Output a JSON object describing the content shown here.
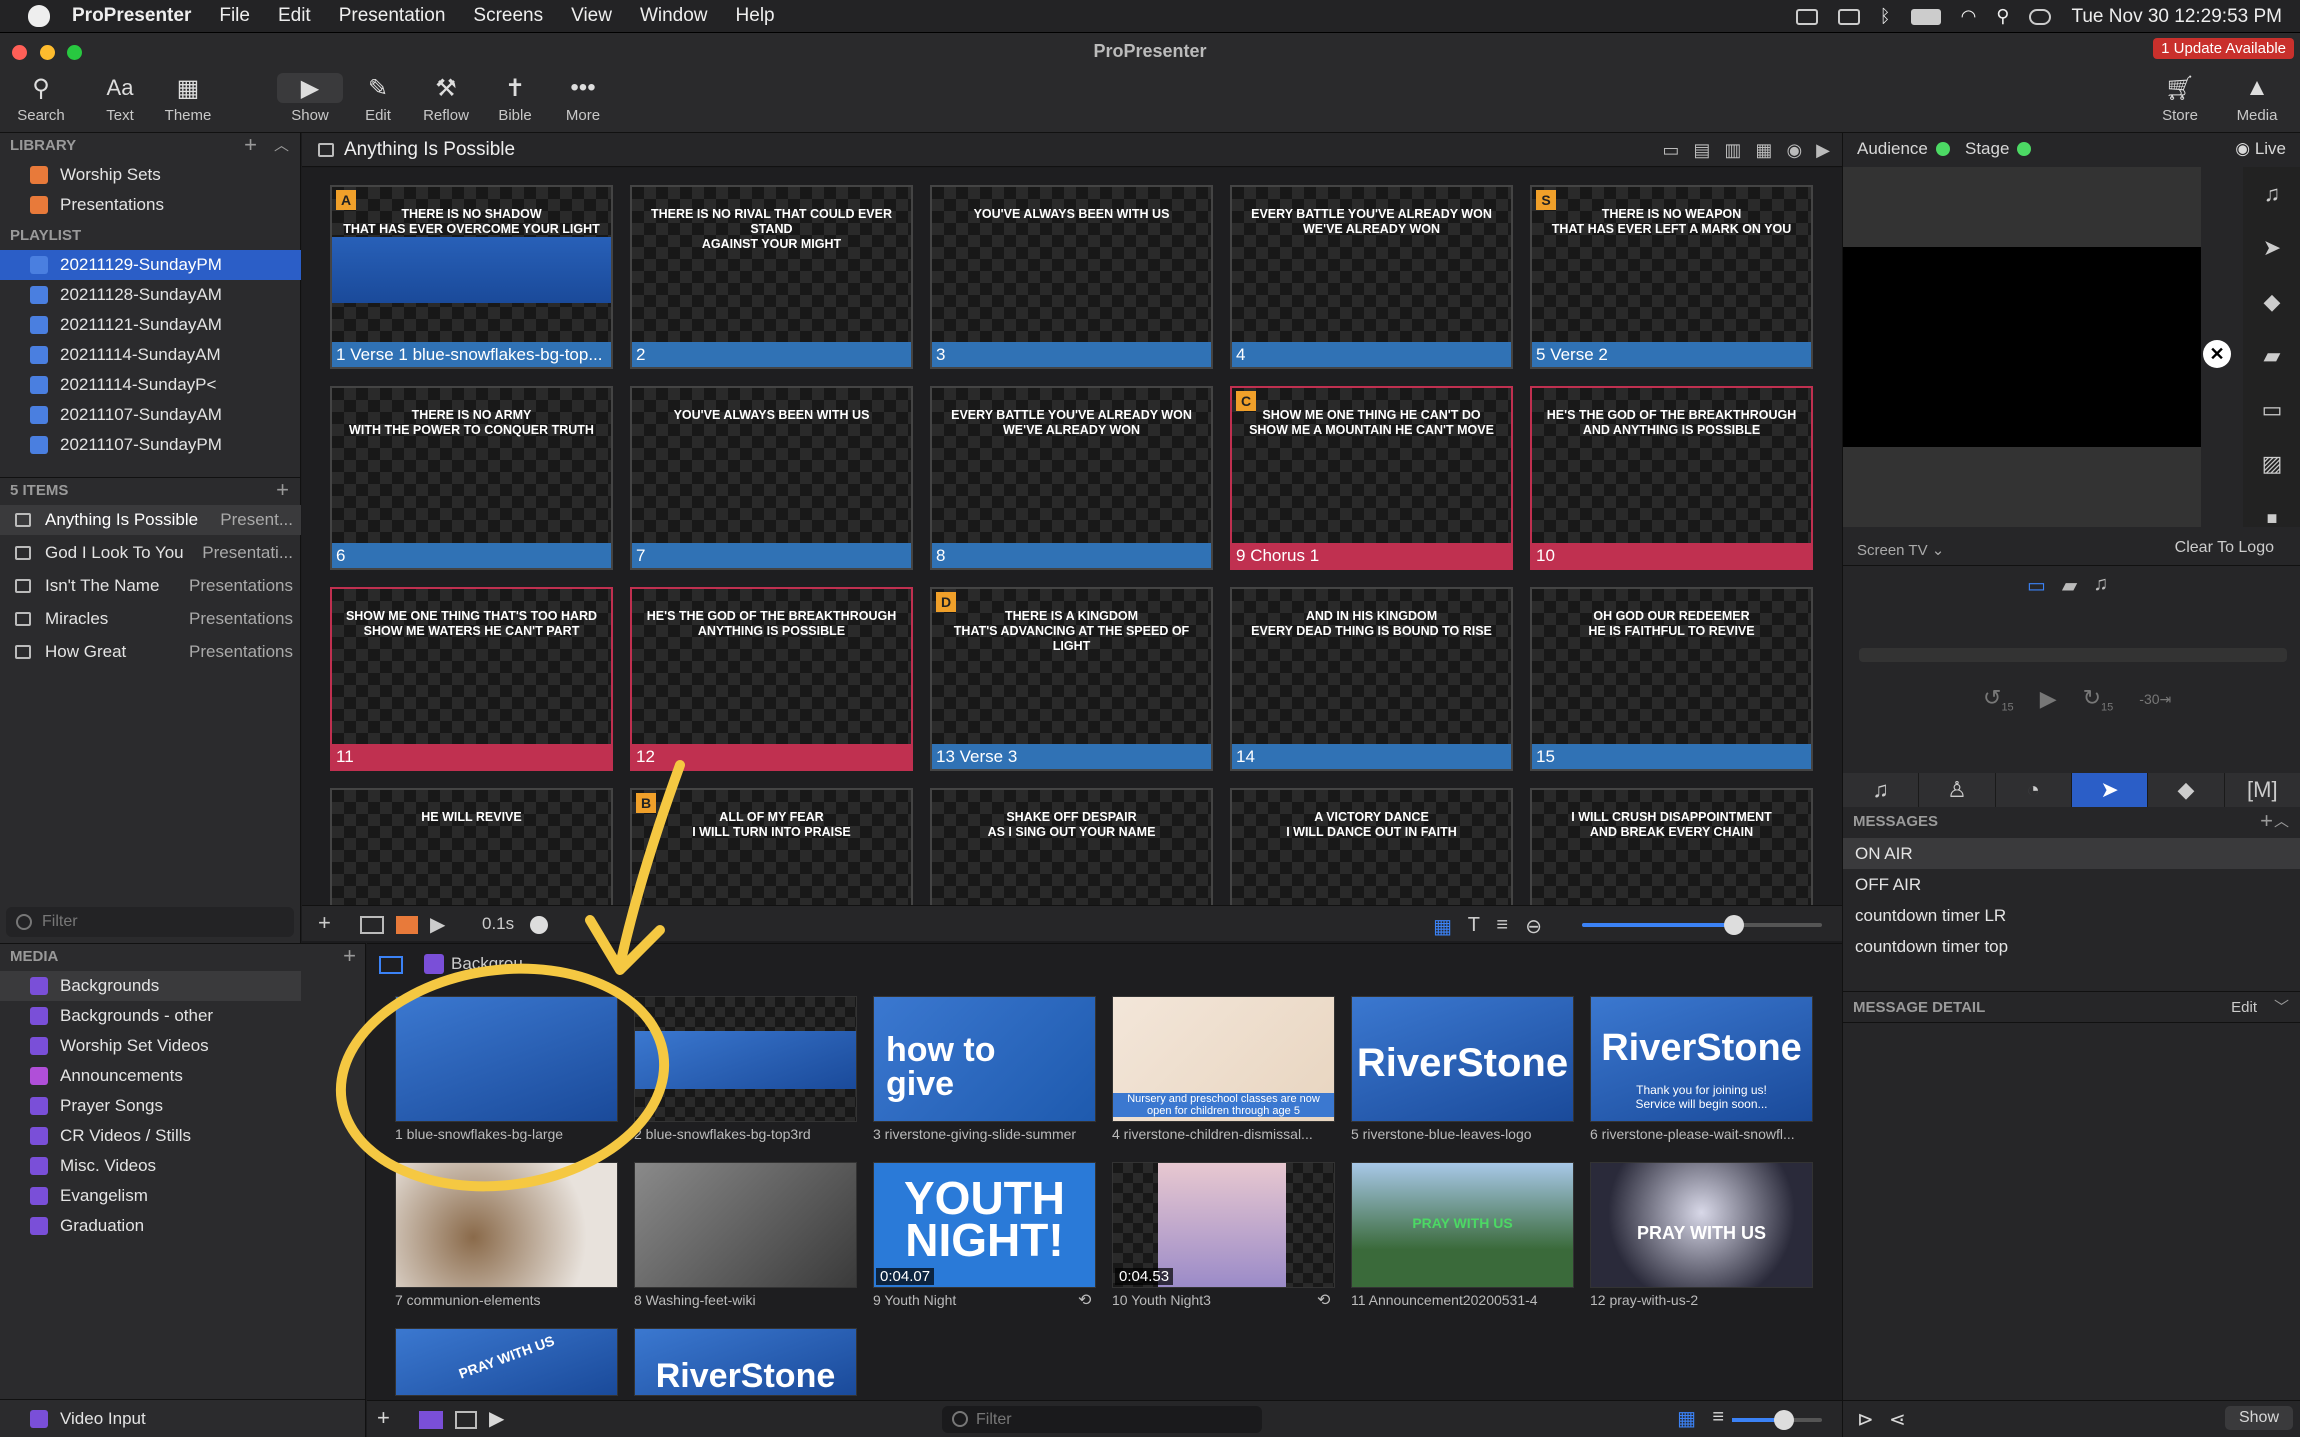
{
  "menubar": {
    "items": [
      "ProPresenter",
      "File",
      "Edit",
      "Presentation",
      "Screens",
      "View",
      "Window",
      "Help"
    ],
    "datetime": "Tue Nov 30  12:29:53 PM"
  },
  "window": {
    "title": "ProPresenter",
    "update_badge": "1 Update Available"
  },
  "toolbar": {
    "left": [
      "Search",
      "Text",
      "Theme"
    ],
    "center": [
      "Show",
      "Edit",
      "Reflow",
      "Bible",
      "More"
    ],
    "right": [
      "Store",
      "Media"
    ]
  },
  "library": {
    "header": "LIBRARY",
    "items": [
      "Worship Sets",
      "Presentations"
    ],
    "playlist_header": "PLAYLIST",
    "playlists": [
      "20211129-SundayPM",
      "20211128-SundayAM",
      "20211121-SundayAM",
      "20211114-SundayAM",
      "20211114-SundayP<",
      "20211107-SundayAM",
      "20211107-SundayPM"
    ],
    "items_header": "5 ITEMS",
    "presentations": [
      {
        "name": "Anything Is Possible",
        "lib": "Present..."
      },
      {
        "name": "God I Look To You",
        "lib": "Presentati..."
      },
      {
        "name": "Isn't The Name",
        "lib": "Presentations"
      },
      {
        "name": "Miracles",
        "lib": "Presentations"
      },
      {
        "name": "How Great",
        "lib": "Presentations"
      }
    ],
    "filter_placeholder": "Filter"
  },
  "document": {
    "title": "Anything Is Possible"
  },
  "slides": [
    {
      "n": "1",
      "label": "Verse 1 blue-snowflakes-bg-top...",
      "text": "THERE IS NO SHADOW\nTHAT HAS EVER OVERCOME YOUR LIGHT",
      "group": "A",
      "color": "blue",
      "bg": true
    },
    {
      "n": "2",
      "label": "",
      "text": "THERE IS NO RIVAL THAT COULD EVER STAND\nAGAINST YOUR MIGHT",
      "group": "",
      "color": "blue"
    },
    {
      "n": "3",
      "label": "",
      "text": "YOU'VE ALWAYS BEEN WITH US",
      "group": "",
      "color": "blue"
    },
    {
      "n": "4",
      "label": "",
      "text": "EVERY BATTLE YOU'VE ALREADY WON\nWE'VE ALREADY WON",
      "group": "",
      "color": "blue"
    },
    {
      "n": "5",
      "label": "Verse 2",
      "text": "THERE IS NO WEAPON\nTHAT HAS EVER LEFT A MARK ON YOU",
      "group": "S",
      "color": "blue"
    },
    {
      "n": "6",
      "label": "",
      "text": "THERE IS NO ARMY\nWITH THE POWER TO CONQUER TRUTH",
      "group": "",
      "color": "blue"
    },
    {
      "n": "7",
      "label": "",
      "text": "YOU'VE ALWAYS BEEN WITH US",
      "group": "",
      "color": "blue"
    },
    {
      "n": "8",
      "label": "",
      "text": "EVERY BATTLE YOU'VE ALREADY WON\nWE'VE ALREADY WON",
      "group": "",
      "color": "blue"
    },
    {
      "n": "9",
      "label": "Chorus 1",
      "text": "SHOW ME ONE THING HE CAN'T DO\nSHOW ME A MOUNTAIN HE CAN'T MOVE",
      "group": "C",
      "color": "red"
    },
    {
      "n": "10",
      "label": "",
      "text": "HE'S THE GOD OF THE BREAKTHROUGH\nAND ANYTHING IS POSSIBLE",
      "group": "",
      "color": "red"
    },
    {
      "n": "11",
      "label": "",
      "text": "SHOW ME ONE THING THAT'S TOO HARD\nSHOW ME WATERS HE CAN'T PART",
      "group": "",
      "color": "red"
    },
    {
      "n": "12",
      "label": "",
      "text": "HE'S THE GOD OF THE BREAKTHROUGH\nANYTHING IS POSSIBLE",
      "group": "",
      "color": "red"
    },
    {
      "n": "13",
      "label": "Verse 3",
      "text": "THERE IS A KINGDOM\nTHAT'S ADVANCING AT THE SPEED OF LIGHT",
      "group": "D",
      "color": "blue"
    },
    {
      "n": "14",
      "label": "",
      "text": "AND IN HIS KINGDOM\nEVERY DEAD THING IS BOUND TO RISE",
      "group": "",
      "color": "blue"
    },
    {
      "n": "15",
      "label": "",
      "text": "OH GOD OUR REDEEMER\nHE IS FAITHFUL TO REVIVE",
      "group": "",
      "color": "blue"
    },
    {
      "n": "16",
      "label": "",
      "text": "HE WILL REVIVE",
      "group": "",
      "color": "blue"
    },
    {
      "n": "17",
      "label": "",
      "text": "ALL OF MY FEAR\nI WILL TURN INTO PRAISE",
      "group": "B",
      "color": "blue"
    },
    {
      "n": "18",
      "label": "",
      "text": "SHAKE OFF DESPAIR\nAS I SING OUT YOUR NAME",
      "group": "",
      "color": "blue"
    },
    {
      "n": "19",
      "label": "",
      "text": "A VICTORY DANCE\nI WILL DANCE OUT IN FAITH",
      "group": "",
      "color": "blue"
    },
    {
      "n": "20",
      "label": "",
      "text": "I WILL CRUSH DISAPPOINTMENT\nAND BREAK EVERY CHAIN",
      "group": "",
      "color": "blue"
    }
  ],
  "grid_footer": {
    "transition": "0.1s"
  },
  "right_panel": {
    "audience": "Audience",
    "stage": "Stage",
    "live": "Live",
    "screen": "Screen TV",
    "clear_logo": "Clear To Logo",
    "rewind": "15",
    "forward": "15",
    "skip": "-30",
    "messages_header": "MESSAGES",
    "messages": [
      "ON AIR",
      "OFF AIR",
      "countdown timer LR",
      "countdown timer top"
    ],
    "detail_header": "MESSAGE DETAIL",
    "detail_edit": "Edit",
    "show_button": "Show"
  },
  "media": {
    "header": "MEDIA",
    "playlists": [
      "Backgrounds",
      "Backgrounds - other",
      "Worship Set Videos",
      "Announcements",
      "Prayer Songs",
      "CR Videos / Stills",
      "Misc. Videos",
      "Evangelism",
      "Graduation"
    ],
    "video_input": "Video Input",
    "crumb": "Backgrou...",
    "filter_placeholder": "Filter",
    "items": [
      "1 blue-snowflakes-bg-large",
      "2 blue-snowflakes-bg-top3rd",
      "3 riverstone-giving-slide-summer",
      "4 riverstone-children-dismissal...",
      "5 riverstone-blue-leaves-logo",
      "6 riverstone-please-wait-snowfl...",
      "7 communion-elements",
      "8 Washing-feet-wiki",
      "9 Youth Night",
      "10 Youth Night3",
      "11 Announcement20200531-4",
      "12 pray-with-us-2"
    ],
    "durations": {
      "9": "0:04.07",
      "10": "0:04.53"
    },
    "thumb_text": {
      "giving": "how to\ngive",
      "riverstone": "RiverStone",
      "thanks": "Thank you for joining us!\nService will begin soon...",
      "nursery": "Nursery and preschool classes are now\nopen for children through age 5",
      "youth": "YOUTH\nNIGHT!",
      "pray": "PRAY WITH US"
    }
  }
}
